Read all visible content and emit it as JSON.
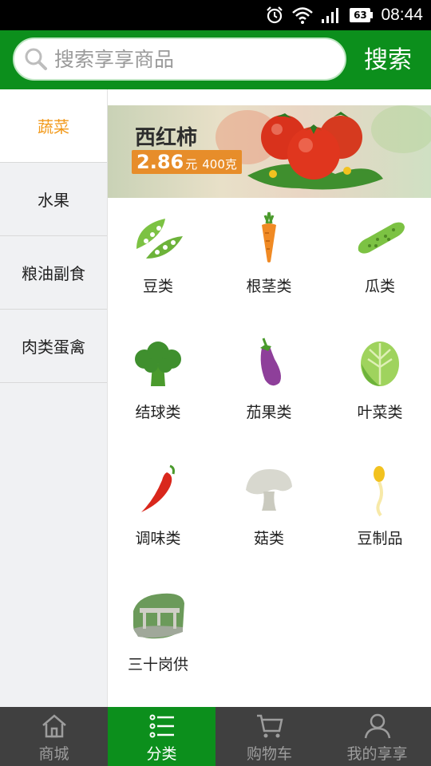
{
  "status_bar": {
    "time": "08:44",
    "battery": "63",
    "icons": [
      "alarm-icon",
      "wifi-icon",
      "signal-icon",
      "battery-icon"
    ]
  },
  "search": {
    "placeholder": "搜索享享商品",
    "value": "",
    "button_label": "搜索"
  },
  "colors": {
    "brand_green": "#0c8f1c",
    "active_category": "#f29a1c",
    "tabbar_bg": "#404040"
  },
  "sidebar": {
    "items": [
      {
        "label": "蔬菜",
        "active": true
      },
      {
        "label": "水果",
        "active": false
      },
      {
        "label": "粮油副食",
        "active": false
      },
      {
        "label": "肉类蛋禽",
        "active": false
      }
    ]
  },
  "banner": {
    "title": "西红柿",
    "price": "2.86",
    "unit": "元",
    "weight": "400克"
  },
  "categories": [
    {
      "label": "豆类",
      "icon": "pea-pod-icon"
    },
    {
      "label": "根茎类",
      "icon": "carrot-icon"
    },
    {
      "label": "瓜类",
      "icon": "cucumber-icon"
    },
    {
      "label": "结球类",
      "icon": "broccoli-icon"
    },
    {
      "label": "茄果类",
      "icon": "eggplant-icon"
    },
    {
      "label": "叶菜类",
      "icon": "cabbage-icon"
    },
    {
      "label": "调味类",
      "icon": "chili-pepper-icon"
    },
    {
      "label": "菇类",
      "icon": "mushroom-icon"
    },
    {
      "label": "豆制品",
      "icon": "bean-sprout-icon"
    },
    {
      "label": "三十岗供",
      "icon": "gateway-photo-icon"
    }
  ],
  "tabbar": {
    "items": [
      {
        "label": "商城",
        "icon": "home-icon",
        "active": false
      },
      {
        "label": "分类",
        "icon": "list-icon",
        "active": true
      },
      {
        "label": "购物车",
        "icon": "cart-icon",
        "active": false
      },
      {
        "label": "我的享享",
        "icon": "user-icon",
        "active": false
      }
    ]
  }
}
